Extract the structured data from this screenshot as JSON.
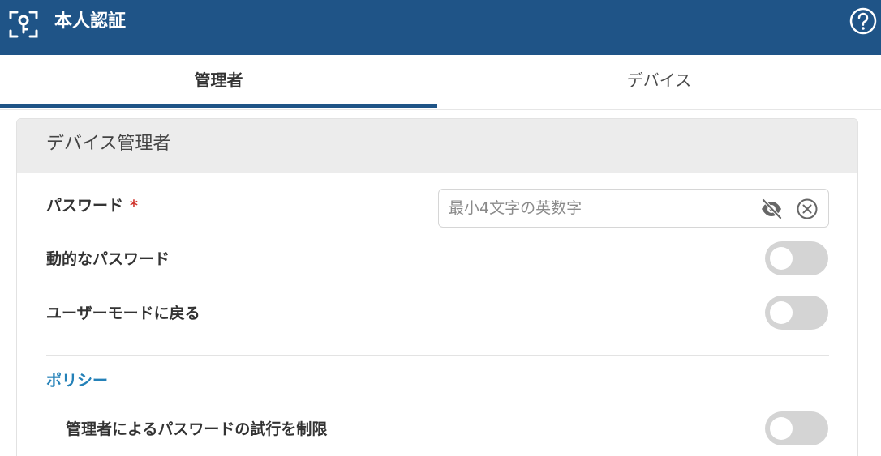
{
  "header": {
    "title": "本人認証",
    "icon": "key-scan-icon",
    "help_icon": "help-circle-icon"
  },
  "tabs": [
    {
      "label": "管理者",
      "active": true
    },
    {
      "label": "デバイス",
      "active": false
    }
  ],
  "card": {
    "title": "デバイス管理者",
    "password": {
      "label": "パスワード",
      "required_mark": "*",
      "value": "",
      "placeholder": "最小4文字の英数字",
      "visibility_icon": "eye-off-icon",
      "clear_icon": "clear-circle-icon"
    },
    "dynamic_password": {
      "label": "動的なパスワード",
      "enabled": false
    },
    "return_user_mode": {
      "label": "ユーザーモードに戻る",
      "enabled": false
    },
    "policy": {
      "title": "ポリシー",
      "limit_attempts": {
        "label": "管理者によるパスワードの試行を制限",
        "enabled": false
      }
    }
  },
  "colors": {
    "header_bg": "#1f5487",
    "accent": "#2481b8",
    "required": "#d0342c",
    "toggle_off": "#d4d4d4"
  }
}
